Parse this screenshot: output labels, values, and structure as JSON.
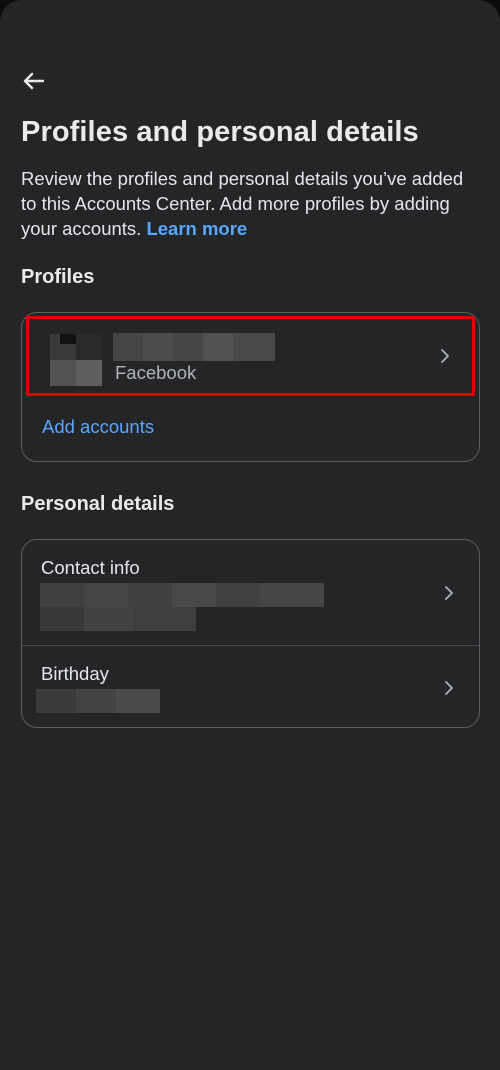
{
  "header": {
    "back_icon": "arrow-left-icon"
  },
  "page": {
    "title": "Profiles and personal details",
    "description": "Review the profiles and personal details you’ve added to this Accounts Center. Add more profiles by adding your accounts. ",
    "learn_more": "Learn more"
  },
  "profiles": {
    "section_title": "Profiles",
    "items": [
      {
        "account_type": "Facebook",
        "name_redacted": true
      }
    ],
    "add_accounts_label": "Add accounts"
  },
  "personal_details": {
    "section_title": "Personal details",
    "contact_info_label": "Contact info",
    "birthday_label": "Birthday"
  },
  "colors": {
    "background": "#242526",
    "accent": "#5aa7ff",
    "highlight": "#e00000",
    "border": "#5b5d60"
  }
}
